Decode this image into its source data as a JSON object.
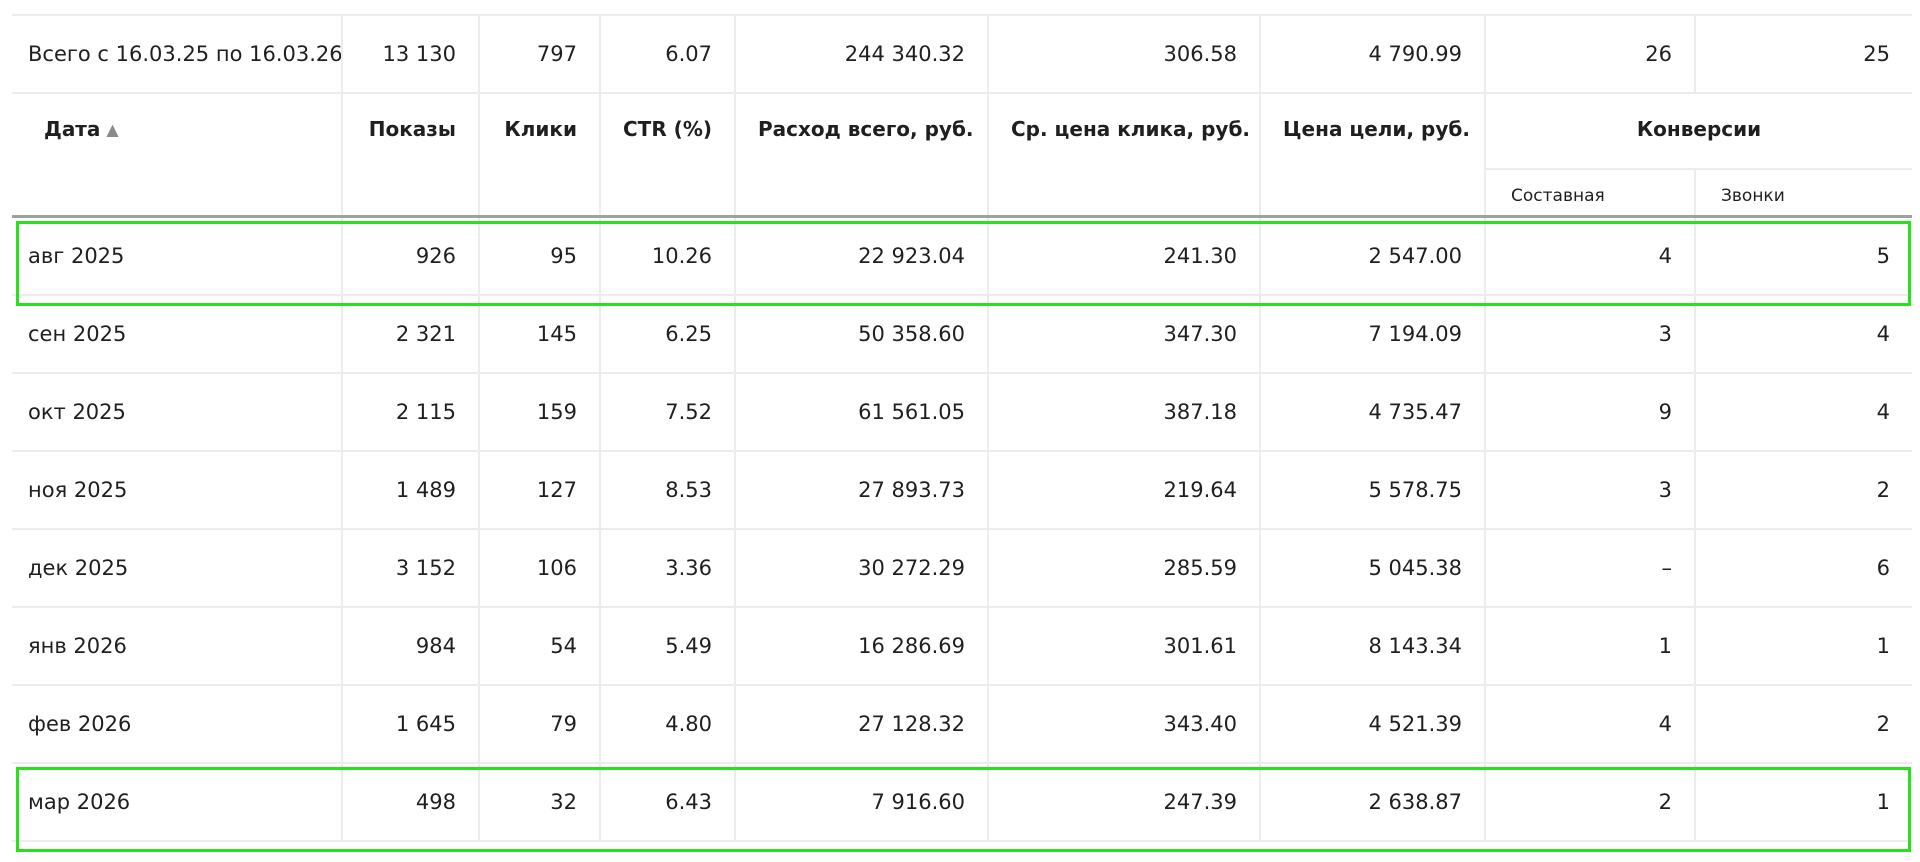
{
  "total": {
    "label": "Всего с 16.03.25 по 16.03.26",
    "shows": "13 130",
    "clicks": "797",
    "ctr": "6.07",
    "spend": "244 340.32",
    "avg_cpc": "306.58",
    "goal_price": "4 790.99",
    "conv_composite": "26",
    "conv_calls": "25"
  },
  "headers": {
    "date": "Дата",
    "sort_indicator": "▲",
    "shows": "Показы",
    "clicks": "Клики",
    "ctr": "CTR (%)",
    "spend": "Расход всего, руб.",
    "avg_cpc": "Ср. цена клика, руб.",
    "goal_price": "Цена цели, руб.",
    "conversions": "Конверсии",
    "conv_composite": "Составная",
    "conv_calls": "Звонки"
  },
  "rows": [
    {
      "date": "авг 2025",
      "shows": "926",
      "clicks": "95",
      "ctr": "10.26",
      "spend": "22 923.04",
      "avg_cpc": "241.30",
      "goal_price": "2 547.00",
      "conv_composite": "4",
      "conv_calls": "5"
    },
    {
      "date": "сен 2025",
      "shows": "2 321",
      "clicks": "145",
      "ctr": "6.25",
      "spend": "50 358.60",
      "avg_cpc": "347.30",
      "goal_price": "7 194.09",
      "conv_composite": "3",
      "conv_calls": "4"
    },
    {
      "date": "окт 2025",
      "shows": "2 115",
      "clicks": "159",
      "ctr": "7.52",
      "spend": "61 561.05",
      "avg_cpc": "387.18",
      "goal_price": "4 735.47",
      "conv_composite": "9",
      "conv_calls": "4"
    },
    {
      "date": "ноя 2025",
      "shows": "1 489",
      "clicks": "127",
      "ctr": "8.53",
      "spend": "27 893.73",
      "avg_cpc": "219.64",
      "goal_price": "5 578.75",
      "conv_composite": "3",
      "conv_calls": "2"
    },
    {
      "date": "дек 2025",
      "shows": "3 152",
      "clicks": "106",
      "ctr": "3.36",
      "spend": "30 272.29",
      "avg_cpc": "285.59",
      "goal_price": "5 045.38",
      "conv_composite": "–",
      "conv_calls": "6"
    },
    {
      "date": "янв 2026",
      "shows": "984",
      "clicks": "54",
      "ctr": "5.49",
      "spend": "16 286.69",
      "avg_cpc": "301.61",
      "goal_price": "8 143.34",
      "conv_composite": "1",
      "conv_calls": "1"
    },
    {
      "date": "фев 2026",
      "shows": "1 645",
      "clicks": "79",
      "ctr": "4.80",
      "spend": "27 128.32",
      "avg_cpc": "343.40",
      "goal_price": "4 521.39",
      "conv_composite": "4",
      "conv_calls": "2"
    },
    {
      "date": "мар 2026",
      "shows": "498",
      "clicks": "32",
      "ctr": "6.43",
      "spend": "7 916.60",
      "avg_cpc": "247.39",
      "goal_price": "2 638.87",
      "conv_composite": "2",
      "conv_calls": "1"
    }
  ],
  "highlight_color": "#27e21a"
}
